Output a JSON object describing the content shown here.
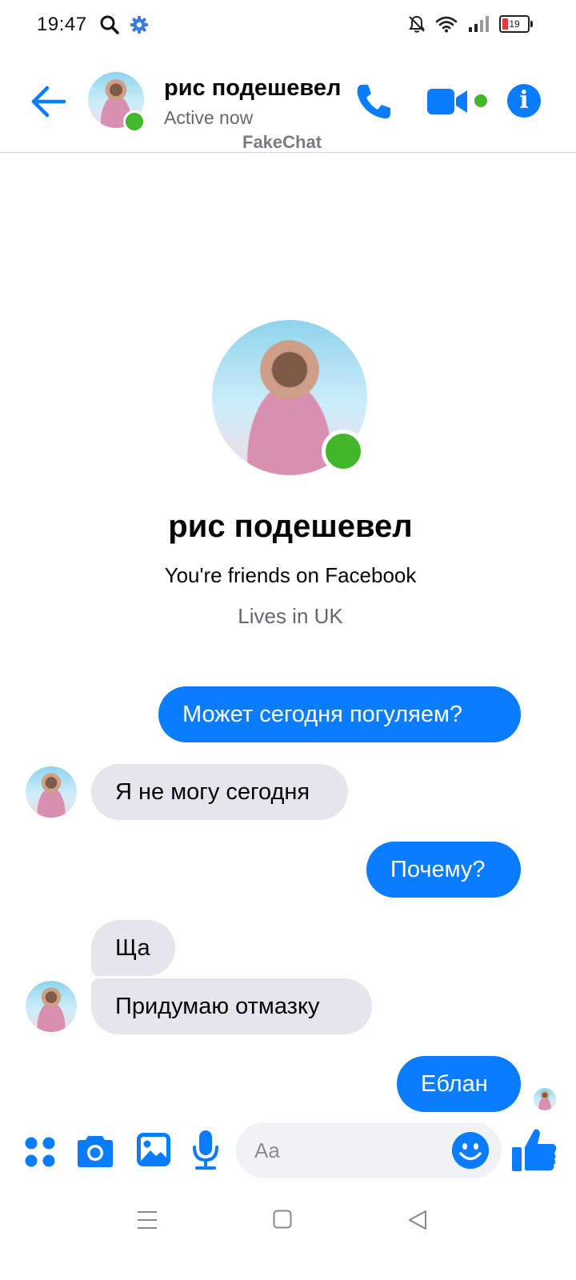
{
  "status_bar": {
    "time": "19:47",
    "battery": "19",
    "icons": [
      "search-icon",
      "gear-icon",
      "mute-bell-icon",
      "wifi-icon",
      "signal-icon",
      "battery-icon"
    ]
  },
  "header": {
    "contact_name": "рис подешевел",
    "status": "Active now",
    "watermark": "FakeChat",
    "info_glyph": "i"
  },
  "profile": {
    "name": "рис подешевел",
    "relationship": "You're friends on Facebook",
    "location": "Lives in UK"
  },
  "messages": [
    {
      "direction": "outgoing",
      "text": "Может сегодня погуляем?"
    },
    {
      "direction": "incoming",
      "text": "Я не могу сегодня"
    },
    {
      "direction": "outgoing",
      "text": "Почему?"
    },
    {
      "direction": "incoming",
      "text": "Ща"
    },
    {
      "direction": "incoming",
      "text": "Придумаю отмазку"
    },
    {
      "direction": "outgoing",
      "text": "Еблан"
    }
  ],
  "composer": {
    "placeholder": "Aa"
  },
  "colors": {
    "accent": "#0a7cff",
    "presence": "#42b72a",
    "incoming_bubble": "#e4e6eb",
    "secondary_text": "#65676b"
  }
}
